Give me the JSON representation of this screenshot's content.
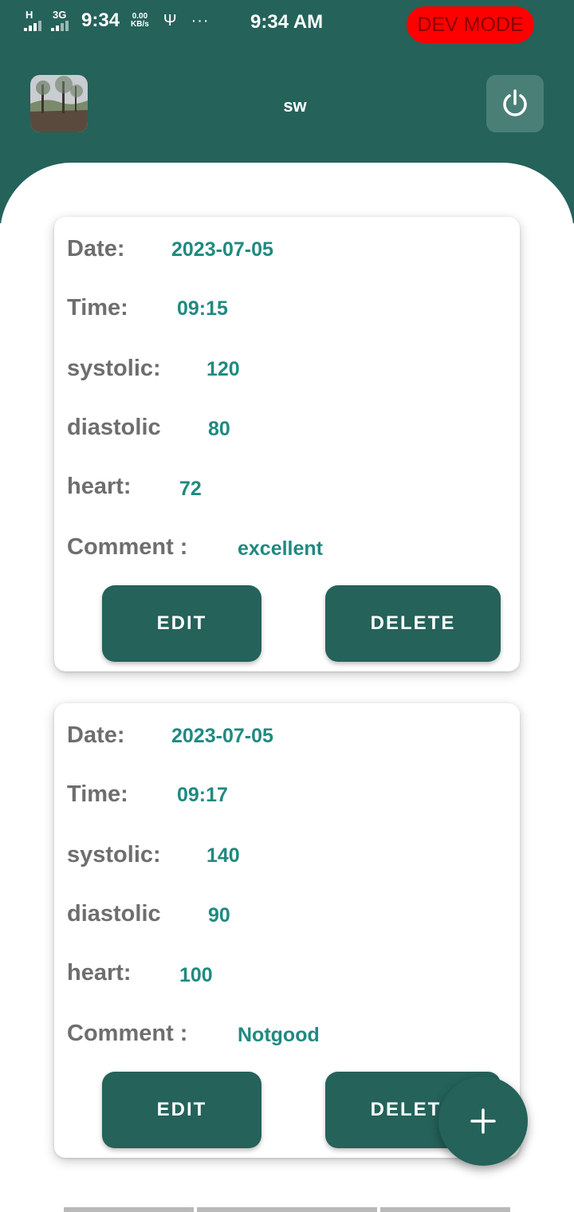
{
  "status_bar": {
    "network_type_1": "H",
    "network_type_2": "3G",
    "time_left": "9:34",
    "speed_value": "0.00",
    "speed_unit": "KB/s",
    "usb_glyph": "Ψ",
    "more_glyph": "···",
    "time_center": "9:34 AM",
    "dev_mode_label": "DEV MODE"
  },
  "header": {
    "username": "sw",
    "avatar_icon": "profile-photo",
    "power_icon": "power-icon"
  },
  "colors": {
    "primary": "#24625a",
    "value_text": "#1f8a80",
    "label_text": "#6e6e6e",
    "dev_mode": "#ff0000"
  },
  "records": [
    {
      "date_label": "Date:",
      "date": "2023-07-05",
      "time_label": "Time:",
      "time": "09:15",
      "systolic_label": "systolic:",
      "systolic": "120",
      "diastolic_label": "diastolic",
      "diastolic": "80",
      "heart_label": "heart:",
      "heart": "72",
      "comment_label": "Comment :",
      "comment": "excellent",
      "edit_label": "EDIT",
      "delete_label": "DELETE"
    },
    {
      "date_label": "Date:",
      "date": "2023-07-05",
      "time_label": "Time:",
      "time": "09:17",
      "systolic_label": "systolic:",
      "systolic": "140",
      "diastolic_label": "diastolic",
      "diastolic": "90",
      "heart_label": "heart:",
      "heart": "100",
      "comment_label": "Comment :",
      "comment": "Notgood",
      "edit_label": "EDIT",
      "delete_label": "DELETE"
    }
  ],
  "fab": {
    "icon": "plus-icon"
  }
}
